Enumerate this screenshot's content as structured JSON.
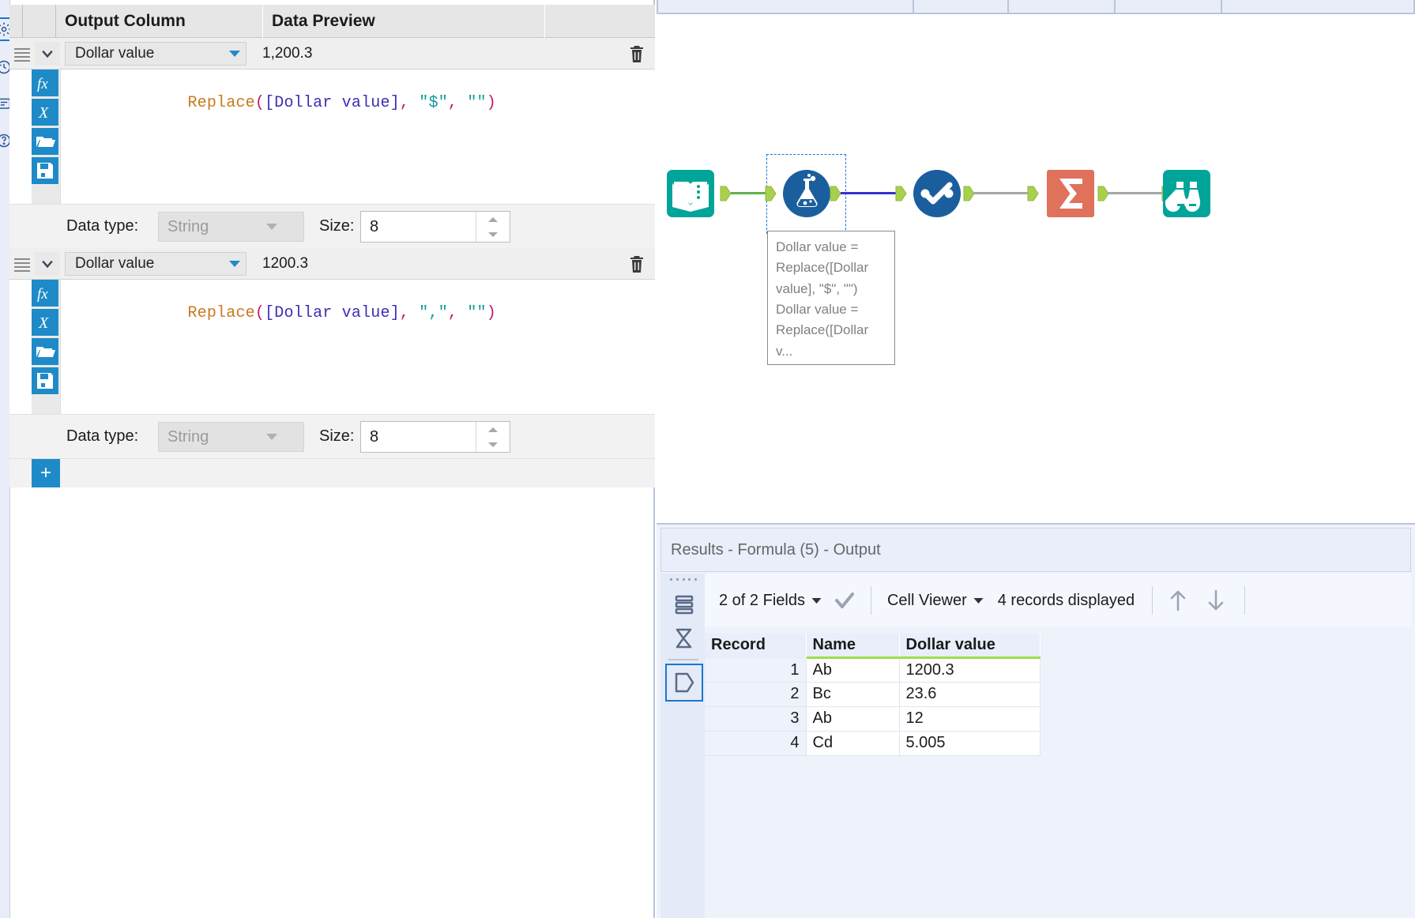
{
  "app": {
    "tool_name": "Formula",
    "canvas": {
      "tabs_count": 5
    }
  },
  "config_panel": {
    "columns": [
      {
        "key": "drag",
        "label": ""
      },
      {
        "key": "output_column",
        "label": "Output Column"
      },
      {
        "key": "data_preview",
        "label": "Data Preview"
      },
      {
        "key": "delete",
        "label": ""
      }
    ],
    "formula_rows": [
      {
        "output_column": "Dollar value",
        "data_preview": "1,200.3",
        "expression": "Replace([Dollar value], \"$\", \"\")",
        "expr_tokens": [
          {
            "t": "Replace",
            "c": "fn"
          },
          {
            "t": "(",
            "c": "par"
          },
          {
            "t": "[Dollar value]",
            "c": "fld"
          },
          {
            "t": ",",
            "c": "par"
          },
          {
            "t": " ",
            "c": "plain"
          },
          {
            "t": "\"$\"",
            "c": "str"
          },
          {
            "t": ",",
            "c": "par"
          },
          {
            "t": " ",
            "c": "plain"
          },
          {
            "t": "\"\"",
            "c": "str"
          },
          {
            "t": ")",
            "c": "par"
          }
        ],
        "data_type_label": "Data type:",
        "data_type_value": "String",
        "size_label": "Size:",
        "size_value": "8",
        "icons": [
          "fx-functions-icon",
          "x-variables-icon",
          "folder-open-icon",
          "save-icon"
        ],
        "delete_icon": "trash-icon"
      },
      {
        "output_column": "Dollar value",
        "data_preview": "1200.3",
        "expression": "Replace([Dollar value], \",\", \"\")",
        "expr_tokens": [
          {
            "t": "Replace",
            "c": "fn"
          },
          {
            "t": "(",
            "c": "par"
          },
          {
            "t": "[Dollar value]",
            "c": "fld"
          },
          {
            "t": ",",
            "c": "par"
          },
          {
            "t": " ",
            "c": "plain"
          },
          {
            "t": "\",\"",
            "c": "str"
          },
          {
            "t": ",",
            "c": "par"
          },
          {
            "t": " ",
            "c": "plain"
          },
          {
            "t": "\"\"",
            "c": "str"
          },
          {
            "t": ")",
            "c": "par"
          }
        ],
        "data_type_label": "Data type:",
        "data_type_value": "String",
        "size_label": "Size:",
        "size_value": "8",
        "icons": [
          "fx-functions-icon",
          "x-variables-icon",
          "folder-open-icon",
          "save-icon"
        ],
        "delete_icon": "trash-icon"
      }
    ],
    "add_button_label": "+"
  },
  "workflow": {
    "nodes": [
      {
        "id": "input-data",
        "icon": "book-input-icon",
        "color": "#00A499",
        "selected": false
      },
      {
        "id": "formula",
        "icon": "flask-formula-icon",
        "color": "#1B5E9E",
        "selected": true
      },
      {
        "id": "data-cleansing",
        "icon": "check-preparation-icon",
        "color": "#1B5E9E",
        "selected": false
      },
      {
        "id": "summarize",
        "icon": "sigma-summarize-icon",
        "color": "#E0715B",
        "selected": false
      },
      {
        "id": "browse",
        "icon": "binoculars-browse-icon",
        "color": "#00A499",
        "selected": false
      }
    ],
    "tooltip": {
      "lines": [
        "Dollar value =",
        "Replace([Dollar",
        "value], \"$\", \"\")",
        "Dollar value =",
        "Replace([Dollar",
        "v..."
      ]
    }
  },
  "results": {
    "title": "Results - Formula (5) - Output",
    "sidebar_icons": [
      "records-view-icon",
      "profile-view-icon",
      "data-view-icon"
    ],
    "toolbar": {
      "fields_label": "2 of 2 Fields",
      "fields_caret": "chevron-down-icon",
      "check_icon": "check-icon",
      "viewer_label": "Cell Viewer",
      "viewer_caret": "chevron-down-icon",
      "records_label": "4 records displayed",
      "up_icon": "arrow-up-icon",
      "down_icon": "arrow-down-icon"
    },
    "table": {
      "headers": [
        "Record",
        "Name",
        "Dollar value"
      ],
      "rows": [
        {
          "record": "1",
          "name": "Ab",
          "dollar_value": "1200.3"
        },
        {
          "record": "2",
          "name": "Bc",
          "dollar_value": "23.6"
        },
        {
          "record": "3",
          "name": "Ab",
          "dollar_value": "12"
        },
        {
          "record": "4",
          "name": "Cd",
          "dollar_value": "5.005"
        }
      ]
    }
  },
  "colors": {
    "accent_blue": "#1e8bc8",
    "selection_blue": "#1a76d2",
    "teal_tool": "#00A499",
    "blue_tool": "#1B5E9E",
    "orange_tool": "#E0715B",
    "anchor_green": "#A8D04E",
    "conn_green": "#5FB14B",
    "conn_blue": "#3333CC",
    "conn_gray": "#A6A6A6",
    "field_underline": "#9ede4a"
  }
}
